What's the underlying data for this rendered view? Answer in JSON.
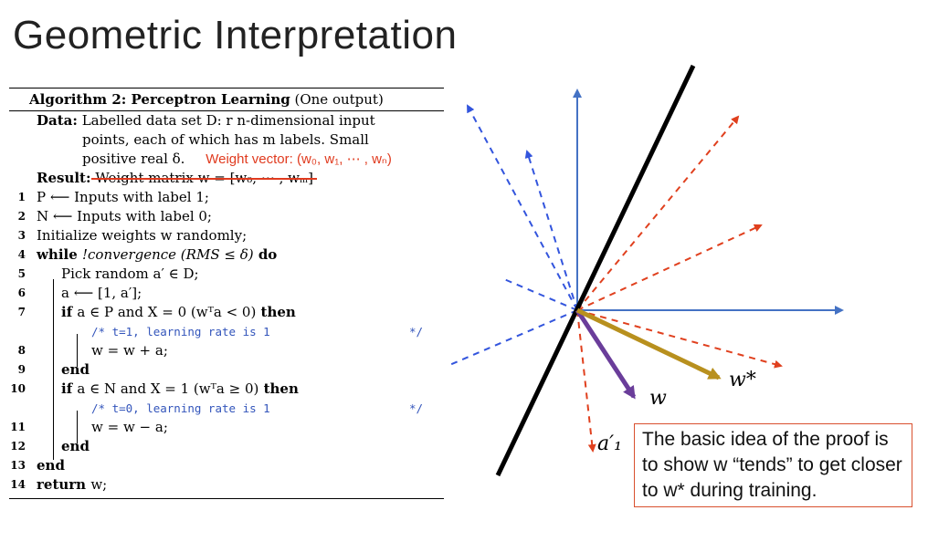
{
  "slide_title": "Geometric Interpretation",
  "algorithm": {
    "heading_bold": "Algorithm 2: Perceptron Learning",
    "heading_rest": "(One output)",
    "data_label": "Data:",
    "data_line1": "Labelled data set D: r n-dimensional input",
    "data_line2": "points, each of which has m labels. Small",
    "data_line3": "positive real δ.",
    "red_annotation": "Weight vector: (w₀, w₁, ⋯ , wₙ)",
    "result_label": "Result:",
    "result_struck": "Weight matrix w = [w₀, ⋯ , wₘ]",
    "lines": [
      {
        "n": "1",
        "text": "P ⟵ Inputs with label 1;"
      },
      {
        "n": "2",
        "text": "N ⟵ Inputs with label 0;"
      },
      {
        "n": "3",
        "text": "Initialize weights w randomly;"
      },
      {
        "n": "4",
        "kw": "while",
        "text": "!convergence (RMS ≤ δ)",
        "kw2": "do"
      },
      {
        "n": "5",
        "text": "Pick random a′ ∈ D;"
      },
      {
        "n": "6",
        "text": "a ⟵ [1, a′];"
      },
      {
        "n": "7",
        "kw": "if",
        "text": "a ∈ P and X = 0 (wᵀa < 0)",
        "kw2": "then"
      },
      {
        "n": "",
        "comment": "/* t=1, learning rate is 1",
        "comment_end": "*/"
      },
      {
        "n": "8",
        "text": "w = w + a;"
      },
      {
        "n": "9",
        "kw": "end"
      },
      {
        "n": "10",
        "kw": "if",
        "text": "a ∈ N and X = 1 (wᵀa ≥ 0)",
        "kw2": "then"
      },
      {
        "n": "",
        "comment": "/* t=0, learning rate is 1",
        "comment_end": "*/"
      },
      {
        "n": "11",
        "text": "w = w − a;"
      },
      {
        "n": "12",
        "kw": "end"
      },
      {
        "n": "13",
        "kw": "end"
      },
      {
        "n": "14",
        "kw": "return",
        "text": "w;"
      }
    ]
  },
  "diagram": {
    "label_w": "w",
    "label_wstar": "w*",
    "label_a1": "a′₁",
    "colors": {
      "axis": "#4472c4",
      "boundary": "#000000",
      "blue_dash": "#3355dd",
      "red_dash": "#e0401e",
      "w": "#6a3d9a",
      "wstar": "#b8901e"
    }
  },
  "note": "The basic idea of the proof is to show w “tends” to get closer to w* during training."
}
